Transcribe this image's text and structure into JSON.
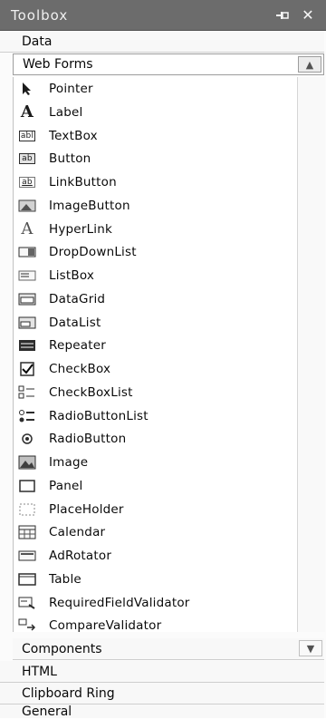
{
  "window": {
    "title": "Toolbox",
    "pin_icon": "pin-icon",
    "close_icon": "close-icon"
  },
  "tabs": {
    "data": "Data",
    "web_forms": "Web Forms",
    "components": "Components",
    "html": "HTML",
    "clipboard_ring": "Clipboard Ring",
    "general": "General"
  },
  "items": [
    {
      "label": "Pointer",
      "icon": "pointer-icon"
    },
    {
      "label": "Label",
      "icon": "label-icon"
    },
    {
      "label": "TextBox",
      "icon": "textbox-icon"
    },
    {
      "label": "Button",
      "icon": "button-icon"
    },
    {
      "label": "LinkButton",
      "icon": "linkbutton-icon"
    },
    {
      "label": "ImageButton",
      "icon": "imagebutton-icon"
    },
    {
      "label": "HyperLink",
      "icon": "hyperlink-icon"
    },
    {
      "label": "DropDownList",
      "icon": "dropdownlist-icon"
    },
    {
      "label": "ListBox",
      "icon": "listbox-icon"
    },
    {
      "label": "DataGrid",
      "icon": "datagrid-icon"
    },
    {
      "label": "DataList",
      "icon": "datalist-icon"
    },
    {
      "label": "Repeater",
      "icon": "repeater-icon"
    },
    {
      "label": "CheckBox",
      "icon": "checkbox-icon"
    },
    {
      "label": "CheckBoxList",
      "icon": "checkboxlist-icon"
    },
    {
      "label": "RadioButtonList",
      "icon": "radiobuttonlist-icon"
    },
    {
      "label": "RadioButton",
      "icon": "radiobutton-icon"
    },
    {
      "label": "Image",
      "icon": "image-icon"
    },
    {
      "label": "Panel",
      "icon": "panel-icon"
    },
    {
      "label": "PlaceHolder",
      "icon": "placeholder-icon"
    },
    {
      "label": "Calendar",
      "icon": "calendar-icon"
    },
    {
      "label": "AdRotator",
      "icon": "adrotator-icon"
    },
    {
      "label": "Table",
      "icon": "table-icon"
    },
    {
      "label": "RequiredFieldValidator",
      "icon": "requiredfieldvalidator-icon"
    },
    {
      "label": "CompareValidator",
      "icon": "comparevalidator-icon"
    }
  ]
}
